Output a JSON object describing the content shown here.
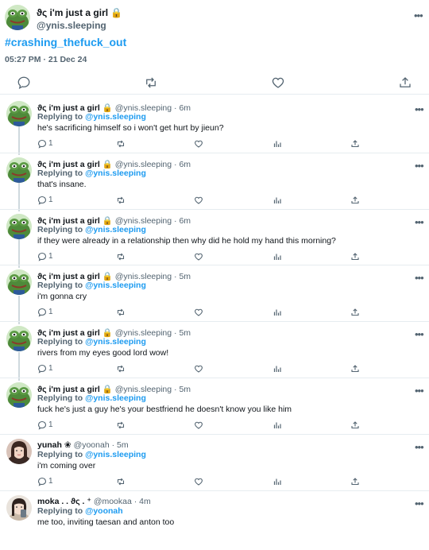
{
  "main": {
    "display_name": "ϑς i'm just a girl 🔒",
    "handle": "@ynis.sleeping",
    "text": "#crashing_thefuck_out",
    "timestamp": "05:27 PM · 21 Dec 24",
    "more": "•••",
    "avatar": "frog-avatar",
    "actions": [
      "reply-icon",
      "retweet-icon",
      "like-icon",
      "share-icon"
    ]
  },
  "replying_prefix": "Replying to",
  "replies": [
    {
      "name": "ϑς i'm just a girl 🔒",
      "meta": "@ynis.sleeping · 6m",
      "replying_to": "@ynis.sleeping",
      "text": "he's sacrificing himself so i won't get hurt by jieun?",
      "reply_count": "1",
      "avatar": "frog-avatar",
      "more": "•••"
    },
    {
      "name": "ϑς i'm just a girl 🔒",
      "meta": "@ynis.sleeping · 6m",
      "replying_to": "@ynis.sleeping",
      "text": "that's insane.",
      "reply_count": "1",
      "avatar": "frog-avatar",
      "more": "•••"
    },
    {
      "name": "ϑς i'm just a girl 🔒",
      "meta": "@ynis.sleeping · 6m",
      "replying_to": "@ynis.sleeping",
      "text": "if they were already in a relationship then why did he hold my hand this morning?",
      "reply_count": "1",
      "avatar": "frog-avatar",
      "more": "•••"
    },
    {
      "name": "ϑς i'm just a girl 🔒",
      "meta": "@ynis.sleeping · 5m",
      "replying_to": "@ynis.sleeping",
      "text": "i'm gonna cry",
      "reply_count": "1",
      "avatar": "frog-avatar",
      "more": "•••"
    },
    {
      "name": "ϑς i'm just a girl 🔒",
      "meta": "@ynis.sleeping · 5m",
      "replying_to": "@ynis.sleeping",
      "text": "rivers from my eyes good lord wow!",
      "reply_count": "1",
      "avatar": "frog-avatar",
      "more": "•••"
    },
    {
      "name": "ϑς i'm just a girl 🔒",
      "meta": "@ynis.sleeping · 5m",
      "replying_to": "@ynis.sleeping",
      "text": "fuck he's just a guy he's your bestfriend he doesn't know you like him",
      "reply_count": "1",
      "avatar": "frog-avatar",
      "more": "•••"
    },
    {
      "name": "yunah ❀",
      "meta": "@yoonah · 5m",
      "replying_to": "@ynis.sleeping",
      "text": "i'm coming over",
      "reply_count": "1",
      "avatar": "yunah-photo-avatar",
      "more": "•••"
    },
    {
      "name": "moka . . ϑς . ⁺",
      "meta": "@mookaa · 4m",
      "replying_to": "@yoonah",
      "text": "me too, inviting taesan and anton too",
      "avatar": "moka-photo-avatar",
      "more": "•••"
    }
  ],
  "reply_action_icons": [
    "reply-icon",
    "retweet-icon",
    "like-icon",
    "views-icon",
    "share-icon"
  ],
  "colors": {
    "link": "#1d9bf0",
    "muted": "#536471",
    "text": "#0f1419",
    "thread_line": "#cfd9de",
    "divider": "#e6ecf0"
  }
}
